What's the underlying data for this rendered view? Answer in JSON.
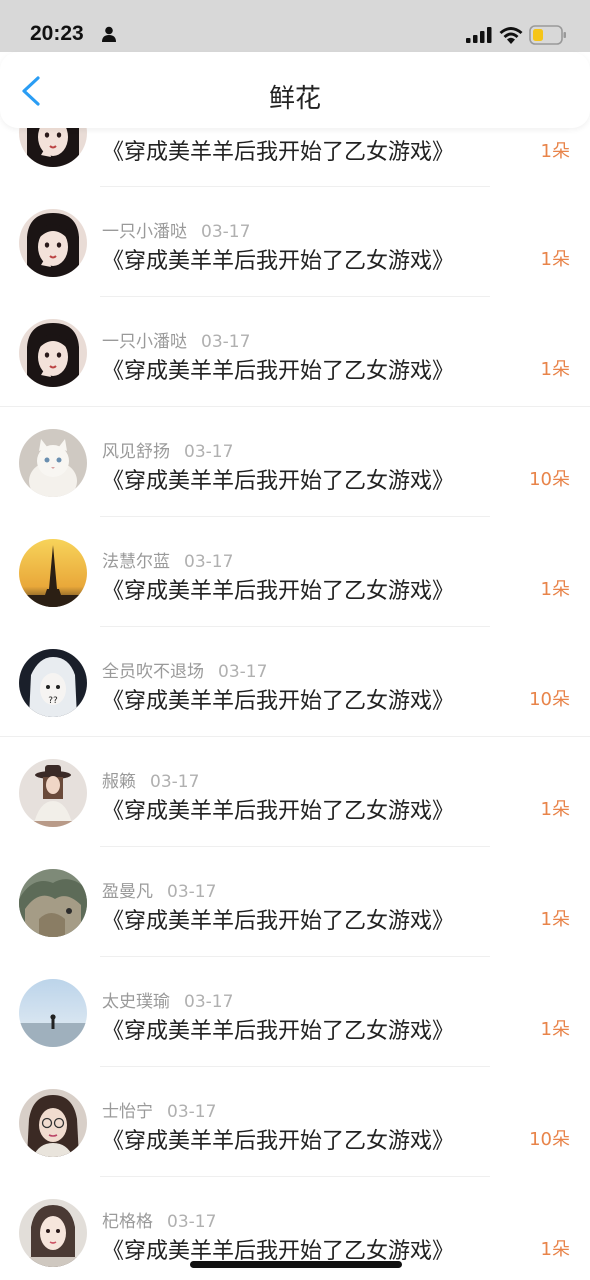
{
  "status_bar": {
    "time": "20:23"
  },
  "header": {
    "title": "鲜花"
  },
  "items": [
    {
      "user": "",
      "date": "",
      "book": "《穿成美羊羊后我开始了乙女游戏》",
      "flowers": "1朵",
      "avatar": "girl-dark-hair"
    },
    {
      "user": "一只小潘哒",
      "date": "03-17",
      "book": "《穿成美羊羊后我开始了乙女游戏》",
      "flowers": "1朵",
      "avatar": "girl-dark-hair"
    },
    {
      "user": "一只小潘哒",
      "date": "03-17",
      "book": "《穿成美羊羊后我开始了乙女游戏》",
      "flowers": "1朵",
      "avatar": "girl-dark-hair"
    },
    {
      "user": "风见舒扬",
      "date": "03-17",
      "book": "《穿成美羊羊后我开始了乙女游戏》",
      "flowers": "10朵",
      "avatar": "white-cat"
    },
    {
      "user": "法慧尔蓝",
      "date": "03-17",
      "book": "《穿成美羊羊后我开始了乙女游戏》",
      "flowers": "1朵",
      "avatar": "eiffel-sunset"
    },
    {
      "user": "全员吹不退场",
      "date": "03-17",
      "book": "《穿成美羊羊后我开始了乙女游戏》",
      "flowers": "10朵",
      "avatar": "anime-white-hair"
    },
    {
      "user": "赧籁",
      "date": "03-17",
      "book": "《穿成美羊羊后我开始了乙女游戏》",
      "flowers": "1朵",
      "avatar": "girl-hat"
    },
    {
      "user": "盈曼凡",
      "date": "03-17",
      "book": "《穿成美羊羊后我开始了乙女游戏》",
      "flowers": "1朵",
      "avatar": "rock-landscape"
    },
    {
      "user": "太史璞瑜",
      "date": "03-17",
      "book": "《穿成美羊羊后我开始了乙女游戏》",
      "flowers": "1朵",
      "avatar": "person-on-beach"
    },
    {
      "user": "士怡宁",
      "date": "03-17",
      "book": "《穿成美羊羊后我开始了乙女游戏》",
      "flowers": "10朵",
      "avatar": "girl-glasses"
    },
    {
      "user": "杞格格",
      "date": "03-17",
      "book": "《穿成美羊羊后我开始了乙女游戏》",
      "flowers": "1朵",
      "avatar": "girl-portrait"
    }
  ],
  "colors": {
    "accent": "#e8844a",
    "back": "#2a9df4"
  }
}
